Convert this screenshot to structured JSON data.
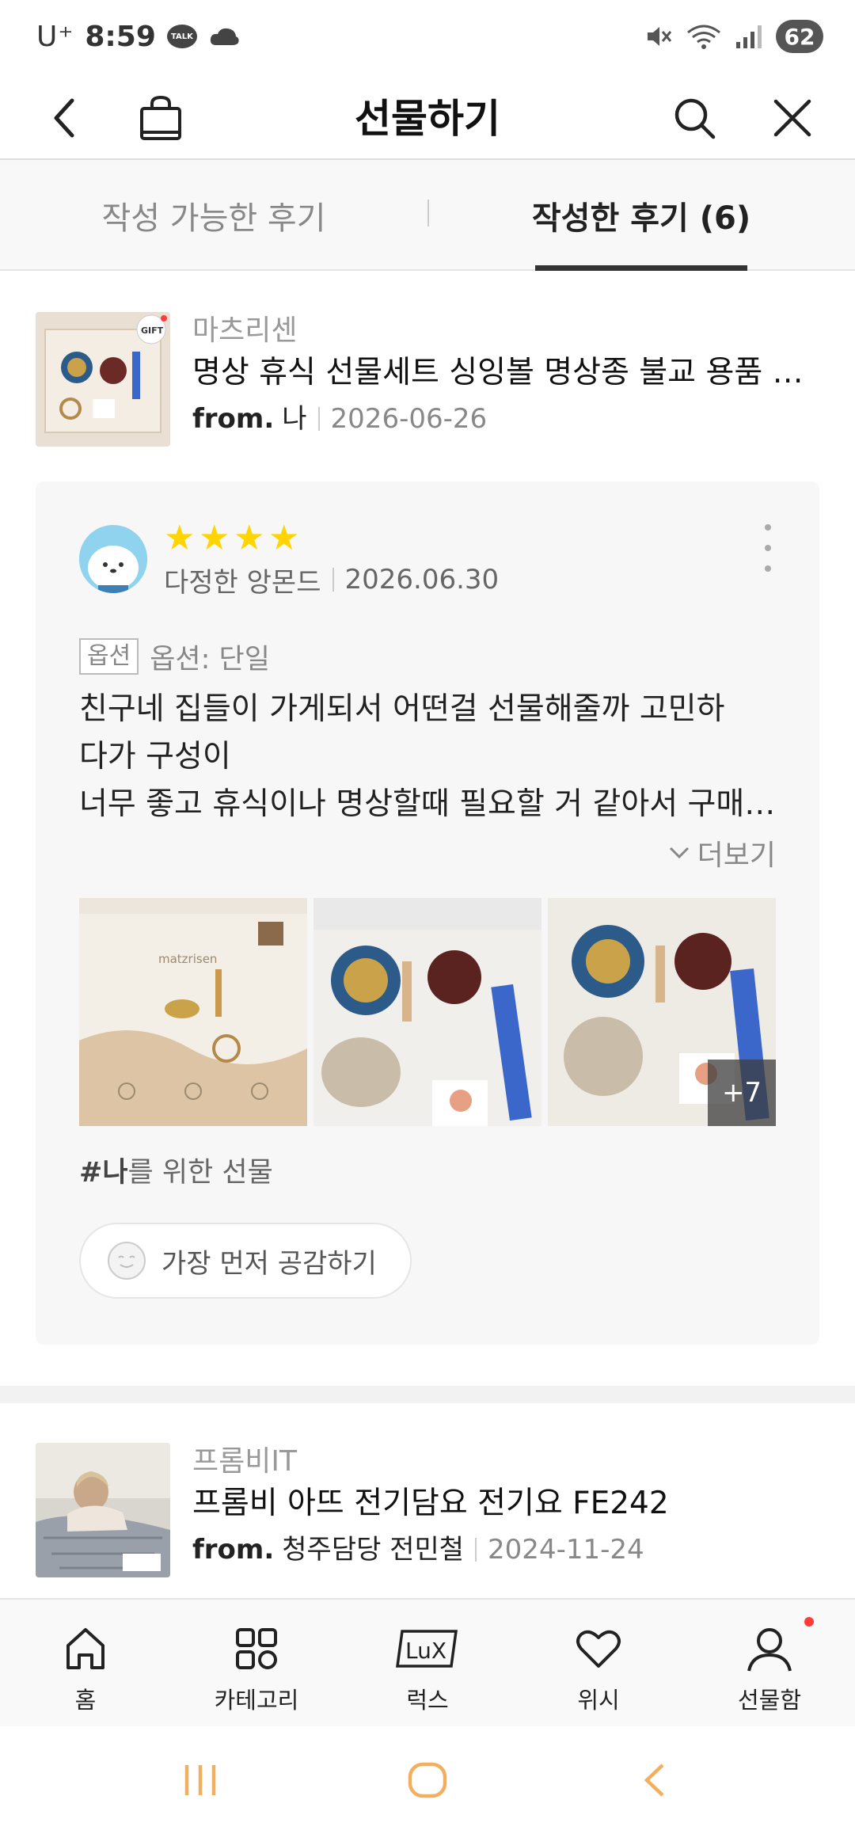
{
  "status_bar": {
    "carrier": "U⁺",
    "time": "8:59",
    "talk_badge": "TALK",
    "battery": "62"
  },
  "header": {
    "title": "선물하기"
  },
  "tabs": {
    "available_label": "작성 가능한 후기",
    "written_label": "작성한 후기 (6)"
  },
  "products": [
    {
      "brand": "마츠리센",
      "name": "명상 휴식 선물세트 싱잉볼 명상종 불교 용품 사찰 선물",
      "from_label": "from.",
      "from_name": "나",
      "date": "2026-06-26"
    },
    {
      "brand": "프롬비IT",
      "name": "프롬비 아뜨 전기담요 전기요 FE242",
      "from_label": "from.",
      "from_name": "청주담당 전민철",
      "date": "2024-11-24"
    }
  ],
  "review": {
    "rating": 4,
    "reviewer": "다정한 앙몬드",
    "date": "2026.06.30",
    "option_badge": "옵션",
    "option_text": "옵션: 단일",
    "lines": [
      "친구네 집들이 가게되서 어떤걸 선물해줄까 고민하",
      "다가 구성이",
      "너무 좋고 휴식이나 명상할때 필요할 거 같아서 구매했어요"
    ],
    "read_more": "더보기",
    "photo_more": "+7",
    "photo_brand": "matzrisen",
    "hashtag_prefix": "#나",
    "hashtag_suffix": "를 위한 선물",
    "like_label": "가장 먼저 공감하기"
  },
  "bottom_nav": [
    {
      "label": "홈",
      "icon": "home-icon"
    },
    {
      "label": "카테고리",
      "icon": "grid-icon"
    },
    {
      "label": "럭스",
      "icon": "lux-icon"
    },
    {
      "label": "위시",
      "icon": "heart-icon"
    },
    {
      "label": "선물함",
      "icon": "person-icon"
    }
  ],
  "colors": {
    "star": "#ffd400",
    "nav_dot": "#ff3b3b",
    "system_nav": "#f0b060"
  }
}
